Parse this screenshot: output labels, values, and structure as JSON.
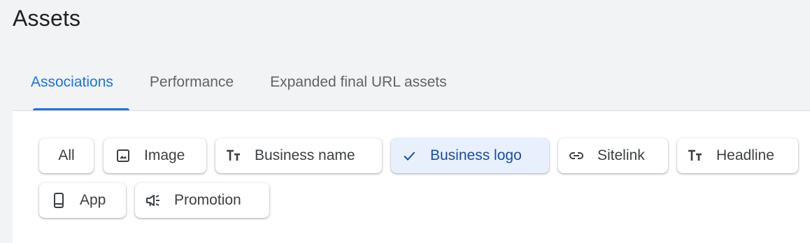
{
  "page": {
    "title": "Assets"
  },
  "tabs": [
    {
      "label": "Associations",
      "active": true
    },
    {
      "label": "Performance",
      "active": false
    },
    {
      "label": "Expanded final URL assets",
      "active": false
    }
  ],
  "filters": {
    "chips": [
      {
        "label": "All",
        "icon": null,
        "selected": false
      },
      {
        "label": "Image",
        "icon": "image-icon",
        "selected": false
      },
      {
        "label": "Business name",
        "icon": "text-icon",
        "selected": false
      },
      {
        "label": "Business logo",
        "icon": "check-icon",
        "selected": true
      },
      {
        "label": "Sitelink",
        "icon": "link-icon",
        "selected": false
      },
      {
        "label": "Headline",
        "icon": "text-icon",
        "selected": false
      },
      {
        "label": "App",
        "icon": "phone-icon",
        "selected": false
      },
      {
        "label": "Promotion",
        "icon": "megaphone-icon",
        "selected": false
      }
    ]
  },
  "colors": {
    "accent": "#1a73e8",
    "selected_chip_bg": "#e8f0fe",
    "selected_chip_text": "#174ea6"
  }
}
